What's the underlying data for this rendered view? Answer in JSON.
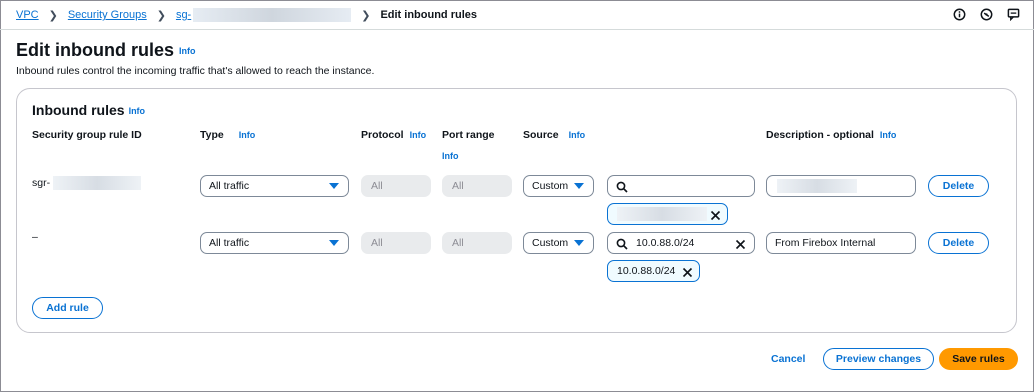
{
  "breadcrumb": {
    "items": [
      "VPC",
      "Security Groups",
      "sg-"
    ],
    "current": "Edit inbound rules"
  },
  "header_icons": [
    "info-circle-icon",
    "notifications-icon",
    "feedback-icon"
  ],
  "page": {
    "title": "Edit inbound rules",
    "title_info": "Info",
    "description": "Inbound rules control the incoming traffic that's allowed to reach the instance."
  },
  "panel": {
    "title": "Inbound rules",
    "title_info": "Info",
    "columns": {
      "rule_id": "Security group rule ID",
      "type": "Type",
      "type_info": "Info",
      "protocol": "Protocol",
      "protocol_info": "Info",
      "port_range": "Port range",
      "port_range_info": "Info",
      "source": "Source",
      "source_info": "Info",
      "description": "Description - optional",
      "description_info": "Info"
    },
    "rules": [
      {
        "rule_id": "sgr-",
        "type": "All traffic",
        "protocol": "All",
        "port_range": "All",
        "source": "Custom",
        "source_search": "",
        "source_token": "",
        "description": "",
        "delete_label": "Delete"
      },
      {
        "rule_id": "–",
        "type": "All traffic",
        "protocol": "All",
        "port_range": "All",
        "source": "Custom",
        "source_search": "10.0.88.0/24",
        "source_token": "10.0.88.0/24",
        "description": "From Firebox Internal",
        "delete_label": "Delete"
      }
    ],
    "add_rule_label": "Add rule"
  },
  "footer": {
    "cancel_label": "Cancel",
    "preview_label": "Preview changes",
    "save_label": "Save rules"
  },
  "colors": {
    "link": "#0972d3",
    "primary_button": "#ff9900",
    "border": "#7d8998"
  }
}
